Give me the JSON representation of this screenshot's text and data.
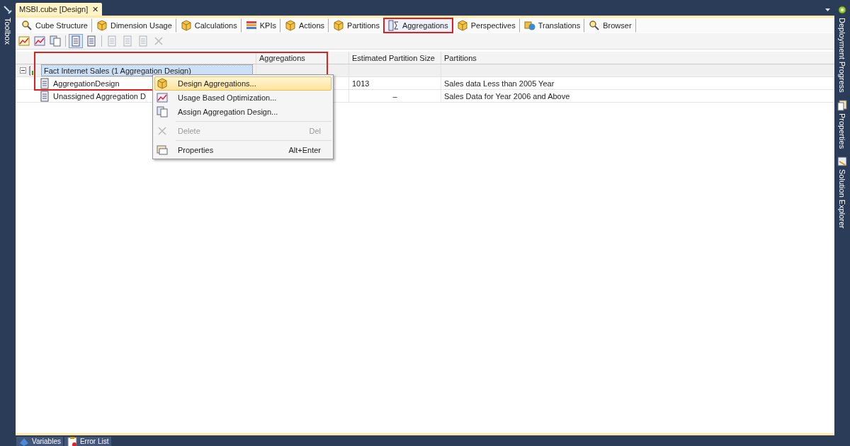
{
  "left_panel": {
    "tabs": [
      "Toolbox"
    ]
  },
  "document_tab": {
    "title": "MSBI.cube [Design]",
    "close": "✕"
  },
  "designer_tabs": [
    {
      "label": "Cube Structure",
      "selected": false,
      "outlined": false
    },
    {
      "label": "Dimension Usage",
      "selected": false,
      "outlined": false
    },
    {
      "label": "Calculations",
      "selected": false,
      "outlined": false
    },
    {
      "label": "KPIs",
      "selected": false,
      "outlined": false
    },
    {
      "label": "Actions",
      "selected": false,
      "outlined": false
    },
    {
      "label": "Partitions",
      "selected": false,
      "outlined": false
    },
    {
      "label": "Aggregations",
      "selected": true,
      "outlined": true
    },
    {
      "label": "Perspectives",
      "selected": false,
      "outlined": false
    },
    {
      "label": "Translations",
      "selected": false,
      "outlined": false
    },
    {
      "label": "Browser",
      "selected": false,
      "outlined": false
    }
  ],
  "toolbar": [
    {
      "kind": "button",
      "pressed": false,
      "disabled": false
    },
    {
      "kind": "button",
      "pressed": false,
      "disabled": false
    },
    {
      "kind": "button",
      "pressed": false,
      "disabled": false
    },
    {
      "kind": "separator"
    },
    {
      "kind": "button",
      "pressed": true,
      "disabled": false
    },
    {
      "kind": "button",
      "pressed": false,
      "disabled": false
    },
    {
      "kind": "separator"
    },
    {
      "kind": "button",
      "pressed": false,
      "disabled": true
    },
    {
      "kind": "button",
      "pressed": false,
      "disabled": true
    },
    {
      "kind": "button",
      "pressed": false,
      "disabled": true
    },
    {
      "kind": "button",
      "pressed": false,
      "disabled": true
    }
  ],
  "grid": {
    "outlined": true,
    "columns": [
      "Aggregations",
      "Estimated Partition Size",
      "Partitions"
    ],
    "rows": [
      {
        "name": "Fact Internet Sales (1 Aggregation Design)",
        "expanded": true,
        "selected": true,
        "children": [
          {
            "name": "AggregationDesign",
            "estimated_size": "1013",
            "partitions": "Sales data Less than 2005 Year",
            "selected": false
          },
          {
            "name": "Unassigned Aggregation D",
            "estimated_size": "–",
            "partitions": "Sales Data for Year 2006 and Above",
            "selected": false
          }
        ]
      }
    ]
  },
  "context_menu": {
    "items": [
      {
        "kind": "item",
        "label": "Design Aggregations...",
        "selected": true,
        "disabled": false
      },
      {
        "kind": "item",
        "label": "Usage Based Optimization...",
        "selected": false,
        "disabled": false
      },
      {
        "kind": "item",
        "label": "Assign Aggregation Design...",
        "selected": false,
        "disabled": false
      },
      {
        "kind": "separator"
      },
      {
        "kind": "item",
        "label": "Delete",
        "shortcut": "Del",
        "selected": false,
        "disabled": true
      },
      {
        "kind": "separator"
      },
      {
        "kind": "item",
        "label": "Properties",
        "shortcut": "Alt+Enter",
        "selected": false,
        "disabled": false
      }
    ]
  },
  "right_panel": {
    "tabs": [
      "Deployment Progress",
      "Properties",
      "Solution Explorer"
    ]
  },
  "bottom_tabs": [
    "Variables",
    "Error List"
  ]
}
